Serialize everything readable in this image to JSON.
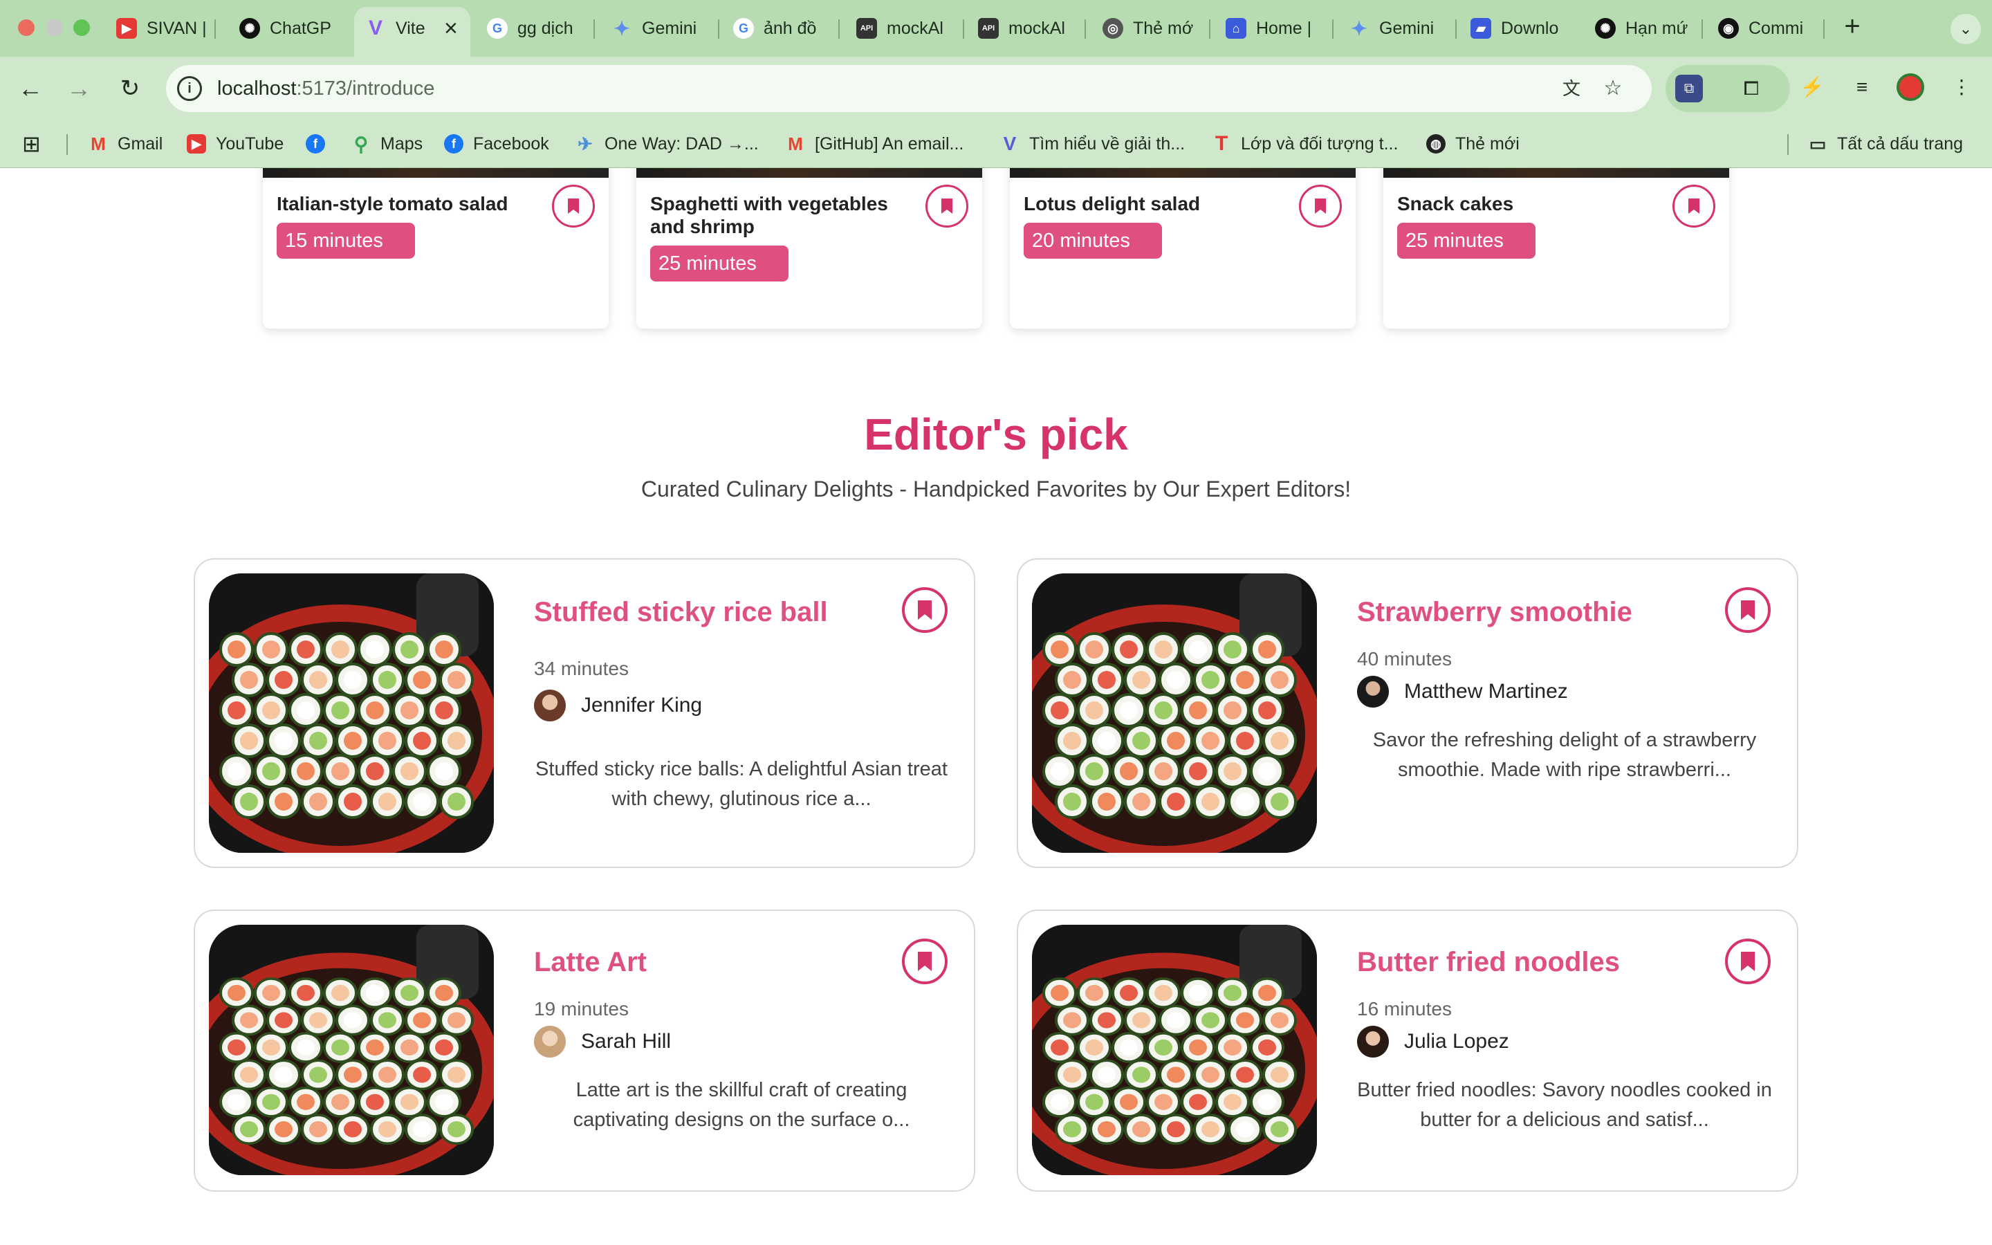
{
  "browser": {
    "tabs": [
      {
        "label": "SIVAN |",
        "icon": "youtube-icon",
        "color": "#e53935"
      },
      {
        "label": "ChatGP",
        "icon": "openai-icon",
        "color": "#111111"
      },
      {
        "label": "Vite",
        "icon": "vite-icon",
        "color": "#8a5cf6",
        "active": true,
        "close": "×"
      },
      {
        "label": "gg dịch",
        "icon": "google-icon",
        "color": "#4285f4"
      },
      {
        "label": "Gemini",
        "icon": "gemini-icon",
        "color": "#5b8def"
      },
      {
        "label": "ảnh đồ",
        "icon": "google-icon",
        "color": "#4285f4"
      },
      {
        "label": "mockAl",
        "icon": "mockapi-icon",
        "color": "#333333"
      },
      {
        "label": "mockAl",
        "icon": "mockapi-icon",
        "color": "#333333"
      },
      {
        "label": "Thẻ mớ",
        "icon": "chrome-icon",
        "color": "#555555"
      },
      {
        "label": "Home |",
        "icon": "home-icon",
        "color": "#3b5bdb"
      },
      {
        "label": "Gemini",
        "icon": "gemini-icon",
        "color": "#5b8def"
      },
      {
        "label": "Downlo",
        "icon": "folder-icon",
        "color": "#3b5bdb"
      },
      {
        "label": "Hạn mứ",
        "icon": "openai-icon",
        "color": "#111111"
      },
      {
        "label": "Commi",
        "icon": "github-icon",
        "color": "#111111"
      }
    ],
    "new_tab": "+",
    "tab_search": "⌄",
    "address": {
      "host": "localhost",
      "path": ":5173/introduce"
    },
    "bookmarks": [
      {
        "label": "Gmail",
        "icon": "gmail-icon",
        "color": "#ea4335"
      },
      {
        "label": "YouTube",
        "icon": "youtube-icon",
        "color": "#e53935"
      },
      {
        "label": "",
        "icon": "facebook-icon",
        "color": "#1877f2"
      },
      {
        "label": "Maps",
        "icon": "maps-icon",
        "color": "#34a853"
      },
      {
        "label": "Facebook",
        "icon": "facebook-icon",
        "color": "#1877f2"
      },
      {
        "label": "One Way: DAD →...",
        "icon": "bird-icon",
        "color": "#4a90d9"
      },
      {
        "label": "[GitHub] An email...",
        "icon": "gmail-icon",
        "color": "#ea4335"
      },
      {
        "label": "Tìm hiểu về giải th...",
        "icon": "v-icon",
        "color": "#5b5bd6"
      },
      {
        "label": "Lớp và đối tượng t...",
        "icon": "t-icon",
        "color": "#e53935"
      },
      {
        "label": "Thẻ mới",
        "icon": "globe-icon",
        "color": "#222222"
      }
    ],
    "all_bookmarks": "Tất cả dấu trang"
  },
  "top_recipes": [
    {
      "title": "Italian-style tomato salad",
      "time": "15 minutes"
    },
    {
      "title": "Spaghetti with vegetables and shrimp",
      "time": "25 minutes"
    },
    {
      "title": "Lotus delight salad",
      "time": "20 minutes"
    },
    {
      "title": "Snack cakes",
      "time": "25 minutes"
    }
  ],
  "editors_pick": {
    "title": "Editor's pick",
    "subtitle": "Curated Culinary Delights - Handpicked Favorites by Our Expert Editors!",
    "items": [
      {
        "name": "Stuffed sticky rice ball",
        "time": "34 minutes",
        "author": "Jennifer King",
        "description": "Stuffed sticky rice balls: A delightful Asian treat with chewy, glutinous rice a..."
      },
      {
        "name": "Strawberry smoothie",
        "time": "40 minutes",
        "author": "Matthew Martinez",
        "description": "Savor the refreshing delight of a strawberry smoothie. Made with ripe strawberri..."
      },
      {
        "name": "Latte Art",
        "time": "19 minutes",
        "author": "Sarah Hill",
        "description": "Latte art is the skillful craft of creating captivating designs on the surface o..."
      },
      {
        "name": "Butter fried noodles",
        "time": "16 minutes",
        "author": "Julia Lopez",
        "description": "Butter fried noodles: Savory noodles cooked in butter for a delicious and satisf..."
      }
    ]
  },
  "colors": {
    "accent": "#d6336c",
    "accent_light": "#e0507f",
    "chrome": "#b7dcb2"
  }
}
